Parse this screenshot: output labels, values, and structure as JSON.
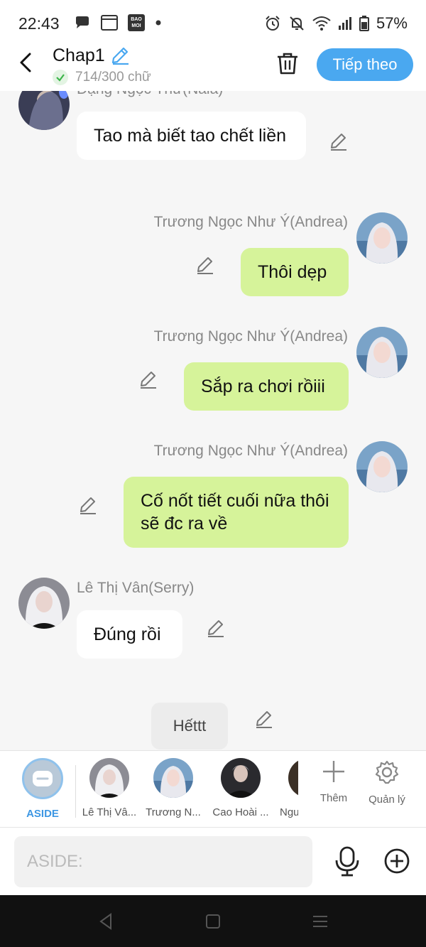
{
  "status_bar": {
    "time": "22:43",
    "baomoi": "BAO MOI",
    "battery": "57%",
    "icons": [
      "chat-bubble-icon",
      "window-icon",
      "baomoi-icon",
      "dot-icon",
      "alarm-icon",
      "mute-bell-icon",
      "wifi-icon",
      "signal-icon",
      "battery-icon"
    ]
  },
  "header": {
    "title": "Chap1",
    "word_count": "714/300 chữ",
    "next_button": "Tiếp theo"
  },
  "messages": [
    {
      "sender": "Đặng Ngọc Thư(Nala)",
      "text": "Tao mà biết tao chết liền",
      "side": "left"
    },
    {
      "sender": "Trương Ngọc Như Ý(Andrea)",
      "text": "Thôi dẹp",
      "side": "right"
    },
    {
      "sender": "Trương Ngọc Như Ý(Andrea)",
      "text": "Sắp ra chơi rồiii",
      "side": "right"
    },
    {
      "sender": "Trương Ngọc Như Ý(Andrea)",
      "text": "Cố nốt tiết cuối nữa thôi sẽ đc ra về",
      "side": "right"
    },
    {
      "sender": "Lê Thị Vân(Serry)",
      "text": "Đúng rồi",
      "side": "left"
    }
  ],
  "end_chip": "Hếttt",
  "character_bar": {
    "aside_label": "ASIDE",
    "characters": [
      "Lê Thị Vâ...",
      "Trương N...",
      "Cao Hoài ...",
      "Ngu"
    ],
    "add_label": "Thêm",
    "manage_label": "Quản lý"
  },
  "input": {
    "placeholder": "ASIDE:"
  },
  "colors": {
    "accent": "#4aa8f0",
    "bubble_right": "#d6f39a",
    "bubble_left": "#ffffff",
    "background": "#f6f6f6"
  }
}
